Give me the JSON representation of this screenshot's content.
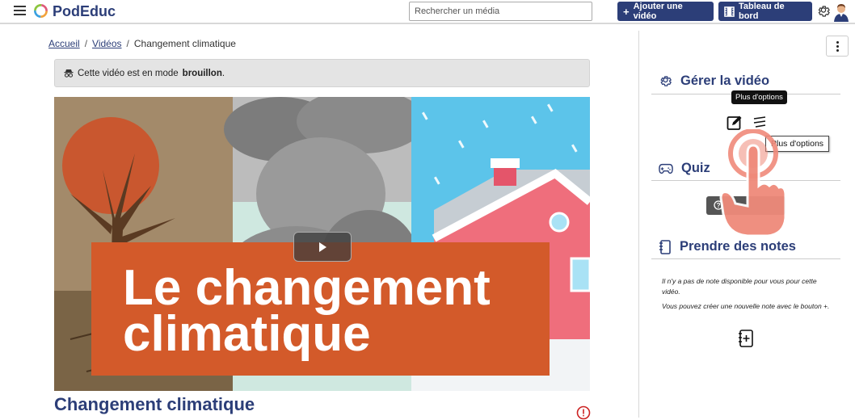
{
  "header": {
    "brand": "PodEduc",
    "search_placeholder": "Rechercher un média",
    "add_video_label": "Ajouter une vidéo",
    "dashboard_label": "Tableau de bord"
  },
  "breadcrumb": {
    "items": [
      "Accueil",
      "Vidéos"
    ],
    "current": "Changement climatique"
  },
  "alert": {
    "prefix": "Cette vidéo est en mode",
    "mode": "brouillon",
    "suffix": "."
  },
  "video": {
    "thumbnail_title_line1": "Le changement",
    "thumbnail_title_line2": "climatique",
    "title": "Changement climatique"
  },
  "manage": {
    "heading": "Gérer la vidéo",
    "tooltip_dark": "Plus d'options",
    "tooltip_light": "Plus d'options"
  },
  "quiz": {
    "heading": "Quiz"
  },
  "notes": {
    "heading": "Prendre des notes",
    "empty_text": "Il n'y a pas de note disponible pour vous pour cette vidéo.",
    "hint_text": "Vous pouvez créer une nouvelle note avec le bouton +."
  },
  "colors": {
    "primary": "#2c3e78",
    "title_banner": "#d35a2a",
    "hand": "#ef8a7a"
  }
}
